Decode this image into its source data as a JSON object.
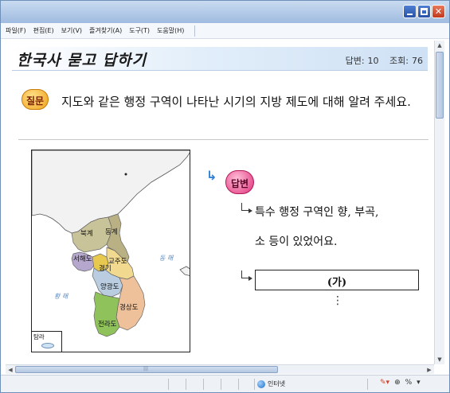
{
  "menu": [
    "파일(F)",
    "편집(E)",
    "보기(V)",
    "즐겨찾기(A)",
    "도구(T)",
    "도움말(H)"
  ],
  "page": {
    "title": "한국사 묻고 답하기",
    "answer_count_label": "답변:",
    "answer_count": "10",
    "view_count_label": "조회:",
    "view_count": "76"
  },
  "question": {
    "badge": "질문",
    "text": "지도와 같은 행정 구역이 나타난 시기의 지방 제도에 대해 알려 주세요."
  },
  "map": {
    "labels": {
      "bukgye": "북계",
      "donggye": "동계",
      "seohaedo": "서해도",
      "gyoju": "교주도",
      "gyeonggi": "경기",
      "yanggwang": "양광도",
      "gyeongsang": "경상도",
      "jeolla": "전라도",
      "tamna": "탐라"
    },
    "seas": {
      "east": "동 해",
      "west": "황 해"
    },
    "colors": {
      "bukgye": "#c9c39a",
      "donggye": "#b9b084",
      "seohaedo": "#b6a7cf",
      "gyeonggi": "#e7c94f",
      "gyoju": "#f1da8f",
      "yanggwang": "#b9cce0",
      "gyeongsang": "#efc19a",
      "jeolla": "#8fc25a",
      "land": "#f2f2f2",
      "sea": "#ffffff"
    }
  },
  "answer": {
    "badge": "답변",
    "line1": "특수 행정 구역인 향, 부곡,",
    "line2": "소 등이 있었어요.",
    "blank": "(가)",
    "dots": "⋮"
  },
  "statusbar": {
    "zone": "인터넷",
    "zoom": "%"
  }
}
